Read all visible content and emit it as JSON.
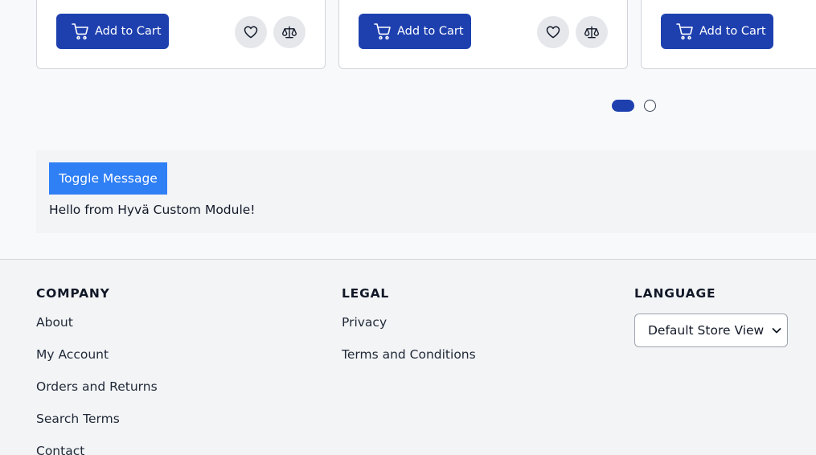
{
  "products": {
    "add_to_cart_label": "Add to Cart",
    "cards": [
      {
        "cart_label": "Add to Cart",
        "wishlist_icon": "heart-icon",
        "compare_icon": "scale-icon"
      },
      {
        "cart_label": "Add to Cart",
        "wishlist_icon": "heart-icon",
        "compare_icon": "scale-icon"
      },
      {
        "cart_label": "Add to Cart"
      }
    ],
    "slider": {
      "pages": 2,
      "active_page": 1
    }
  },
  "custom_module": {
    "toggle_label": "Toggle Message",
    "message": "Hello from Hyvä Custom Module!"
  },
  "footer": {
    "company": {
      "heading": "COMPANY",
      "links": [
        "About",
        "My Account",
        "Orders and Returns",
        "Search Terms",
        "Contact"
      ]
    },
    "legal": {
      "heading": "LEGAL",
      "links": [
        "Privacy",
        "Terms and Conditions"
      ]
    },
    "language": {
      "heading": "LANGUAGE",
      "selected": "Default Store View"
    }
  },
  "colors": {
    "primary": "#1e40af",
    "toggle_button": "#2f7ff5"
  }
}
